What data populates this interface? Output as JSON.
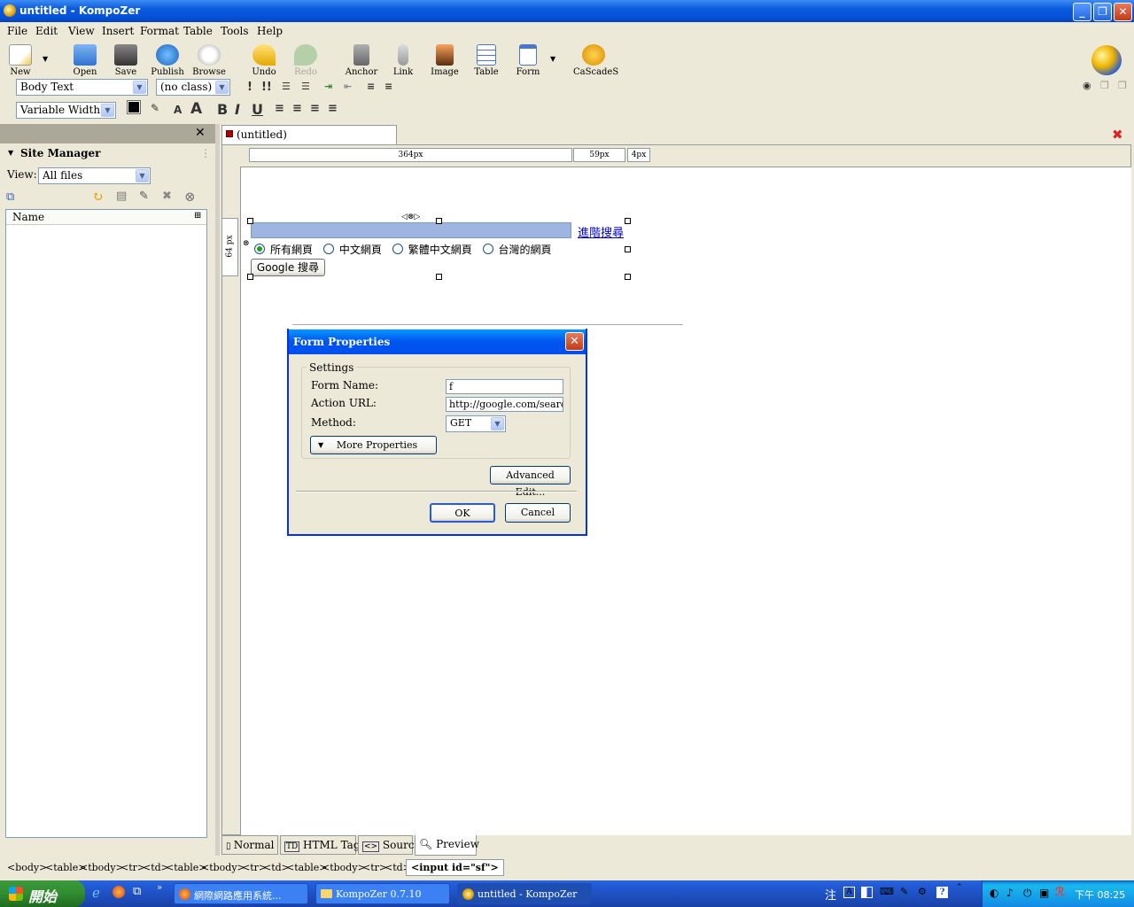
{
  "window": {
    "title": "untitled - KompoZer"
  },
  "menu": [
    "File",
    "Edit",
    "View",
    "Insert",
    "Format",
    "Table",
    "Tools",
    "Help"
  ],
  "toolbar": {
    "buttons": [
      "New",
      "Open",
      "Save",
      "Publish",
      "Browse",
      "Undo",
      "Redo",
      "Anchor",
      "Link",
      "Image",
      "Table",
      "Form",
      "CaScadeS"
    ]
  },
  "format": {
    "paragraph": "Body Text",
    "class": "(no class)",
    "font": "Variable Width"
  },
  "sidebar": {
    "title": "Site Manager",
    "view_label": "View:",
    "view_value": "All files",
    "column": "Name"
  },
  "tab": {
    "label": "(untitled)"
  },
  "rulers": [
    "364px",
    "59px",
    "4px"
  ],
  "vruler": "64 px",
  "page": {
    "link": "進階搜尋",
    "radios": [
      "所有網頁",
      "中文網頁",
      "繁體中文網頁",
      "台灣的網頁"
    ],
    "submit": "Google 搜尋"
  },
  "dialog": {
    "title": "Form Properties",
    "group": "Settings",
    "form_name_label": "Form Name:",
    "form_name": "f",
    "action_label": "Action URL:",
    "action": "http://google.com/search",
    "method_label": "Method:",
    "method": "GET",
    "more": "More Properties",
    "advanced": "Advanced Edit...",
    "ok": "OK",
    "cancel": "Cancel"
  },
  "viewtabs": [
    "Normal",
    "HTML Tags",
    "Source",
    "Preview"
  ],
  "crumbs": [
    "<body>",
    "<table>",
    "<tbody>",
    "<tr>",
    "<td>",
    "<table>",
    "<tbody>",
    "<tr>",
    "<td>",
    "<table>",
    "<tbody>",
    "<tr>",
    "<td>"
  ],
  "crumb_active": "<input id=\"sf\">",
  "taskbar": {
    "start": "開始",
    "tasks": [
      "網際網路應用系統...",
      "KompoZer 0.7.10",
      "untitled - KompoZer"
    ],
    "clock": "下午 08:25"
  }
}
